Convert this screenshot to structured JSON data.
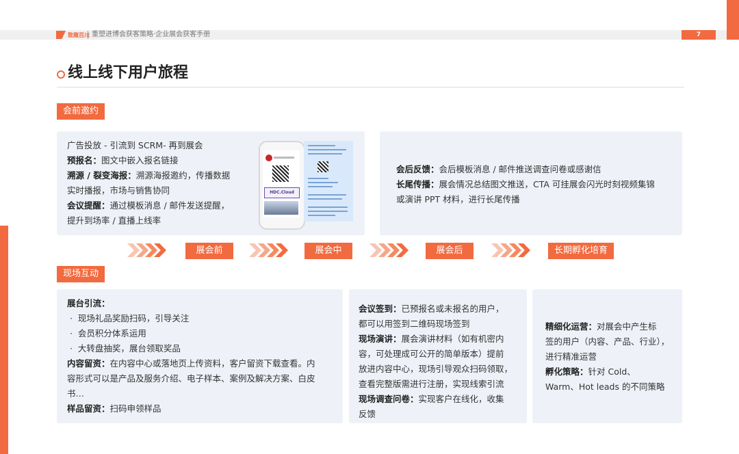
{
  "header": {
    "logo_text": "致趣百川",
    "doc_title": "重塑进博会获客策略·企业展会获客手册",
    "page_number": "7"
  },
  "page_title": "线上线下用户旅程",
  "sections": {
    "pre": "会前邀约",
    "onsite": "现场互动"
  },
  "pre_panel": {
    "line1": "广告投放 - 引流到 SCRM- 再到展会",
    "signup_label": "预报名：",
    "signup_text": "图文中嵌入报名链接",
    "trace_label": "溯源 / 裂变海报：",
    "trace_text": "溯源海报邀约，传播数据",
    "trace_text2": "实时播报，市场与销售协同",
    "remind_label": "会议提醒：",
    "remind_text": "通过模板消息 / 邮件发送提醒，",
    "remind_text2": "提升到场率 / 直播上线率",
    "phone_label": "HDC.Cloud"
  },
  "post_panel": {
    "feedback_label": "会后反馈：",
    "feedback_text": "会后模板消息 / 邮件推送调查问卷或感谢信",
    "tail_label": "长尾传播：",
    "tail_text": "展会情况总结图文推送，CTA 可挂展会闪光时刻视频集锦",
    "tail_text2": "或演讲 PPT 材料，进行长尾传播"
  },
  "stages": [
    "展会前",
    "展会中",
    "展会后",
    "长期孵化培育"
  ],
  "booth_panel": {
    "heading": "展台引流：",
    "bullets": [
      "现场礼品奖励扫码，引导关注",
      "会员积分体系运用",
      "大转盘抽奖，展台领取奖品"
    ],
    "content_label": "内容留资：",
    "content_text": "在内容中心或落地页上传资料，客户留资下载查看。内",
    "content_text2": "容形式可以是产品及服务介绍、电子样本、案例及解决方案、白皮",
    "content_text3": "书…",
    "sample_label": "样品留资：",
    "sample_text": "扫码申领样品"
  },
  "meeting_panel": {
    "checkin_label": "会议签到：",
    "checkin_text": "已预报名或未报名的用户，",
    "checkin_text2": "都可以用签到二维码现场签到",
    "speech_label": "现场演讲：",
    "speech_text": "展会演讲材料（如有机密内",
    "speech_text2": "容，可处理成可公开的简单版本）提前",
    "speech_text3": "放进内容中心，现场引导观众扫码领取，",
    "speech_text4": "查看完整版需进行注册，实现线索引流",
    "survey_label": "现场调查问卷：",
    "survey_text": "实现客户在线化，收集",
    "survey_text2": "反馈"
  },
  "nurture_panel": {
    "ops_label": "精细化运营：",
    "ops_text": "对展会中产生标",
    "ops_text2": "签的用户（内容、产品、行业），",
    "ops_text3": "进行精准运营",
    "incubate_label": "孵化策略：",
    "incubate_text": "针对 Cold、",
    "incubate_text2": "Warm、Hot leads 的不同策略"
  },
  "colors": {
    "accent": "#f26a3f",
    "panel_bg": "#eef2f8"
  }
}
